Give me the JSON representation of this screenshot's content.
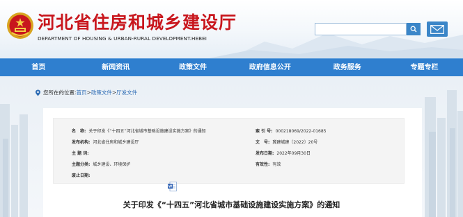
{
  "header": {
    "title_cn": "河北省住房和城乡建设厅",
    "title_en": "DEPARTMENT OF HOUSING & URBAN-RURAL DEVELOPMENT.HEBEI",
    "search_placeholder": "",
    "search_icon": "search-icon",
    "mail_icon": "mail-icon"
  },
  "nav": {
    "items": [
      "首页",
      "新闻资讯",
      "政策文件",
      "政府信息公开",
      "政务服务",
      "专题专栏"
    ]
  },
  "breadcrumb": {
    "prefix": "您所在的位置:",
    "home": "首页",
    "sep1": ">",
    "level2": "政策文件",
    "sep2": ">",
    "level3": "厅发文件"
  },
  "meta": {
    "name_label": "名　称:",
    "name_value": "关于印发《“十四五”河北省城市基础设施建设实施方案》的通知",
    "publisher_label": "发布机构:",
    "publisher_value": "河北省住房和城乡建设厅",
    "subject_label": "主 题 词:",
    "subject_value": "",
    "category_label": "主题分类:",
    "category_value": "城乡建设、环境保护",
    "deadline_label": "废止日期:",
    "deadline_value": "",
    "index_label": "索 引 号:",
    "index_value": "000218069/2022-01685",
    "docno_label": "文　号:",
    "docno_value": "冀建城建〔2022〕20号",
    "date_label": "发布日期:",
    "date_value": "2022年09月30日",
    "validity_label": "有效性:",
    "validity_value": "有效"
  },
  "document": {
    "title": "关于印发《“十四五”河北省城市基础设施建设实施方案》的通知",
    "icon": "word-document-icon"
  },
  "colors": {
    "brand_red": "#c8161d",
    "nav_blue": "#2f7fcf",
    "link_blue": "#2f6db5"
  }
}
